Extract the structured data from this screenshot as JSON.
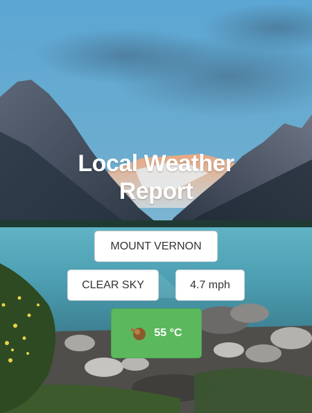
{
  "header": {
    "title_line1": "Local Weather",
    "title_line2": "Report"
  },
  "weather": {
    "location": "MOUNT VERNON",
    "condition": "CLEAR SKY",
    "wind_speed": "4.7 mph",
    "temperature": "55 °C",
    "temperature_icon": "weather-icon"
  },
  "colors": {
    "temperature_bg": "#5cb85c",
    "card_bg": "#ffffff",
    "title_text": "#ffffff"
  }
}
